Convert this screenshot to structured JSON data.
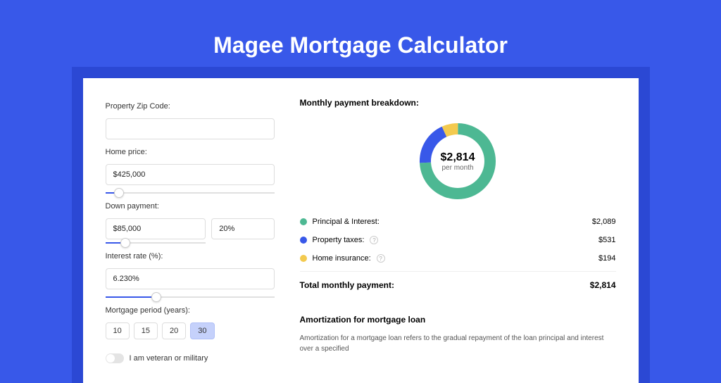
{
  "title": "Magee Mortgage Calculator",
  "form": {
    "zip_label": "Property Zip Code:",
    "zip_value": "",
    "home_price_label": "Home price:",
    "home_price_value": "$425,000",
    "home_price_slider_pos": 8,
    "down_payment_label": "Down payment:",
    "down_payment_value": "$85,000",
    "down_payment_pct_value": "20%",
    "down_payment_slider_pos": 20,
    "rate_label": "Interest rate (%):",
    "rate_value": "6.230%",
    "rate_slider_pos": 30,
    "period_label": "Mortgage period (years):",
    "periods": [
      "10",
      "15",
      "20",
      "30"
    ],
    "selected_period": "30",
    "veteran_label": "I am veteran or military",
    "veteran_on": false
  },
  "breakdown": {
    "heading": "Monthly payment breakdown:",
    "total_value": "$2,814",
    "total_sub": "per month",
    "items": [
      {
        "label": "Principal & Interest:",
        "value": "$2,089",
        "color": "#4db893",
        "has_info": false
      },
      {
        "label": "Property taxes:",
        "value": "$531",
        "color": "#3858e9",
        "has_info": true
      },
      {
        "label": "Home insurance:",
        "value": "$194",
        "color": "#f3ca4f",
        "has_info": true
      }
    ],
    "total_row_label": "Total monthly payment:",
    "total_row_value": "$2,814"
  },
  "amort": {
    "heading": "Amortization for mortgage loan",
    "text": "Amortization for a mortgage loan refers to the gradual repayment of the loan principal and interest over a specified"
  },
  "chart_data": {
    "type": "pie",
    "title": "Monthly payment breakdown",
    "series": [
      {
        "name": "Principal & Interest",
        "value": 2089,
        "color": "#4db893"
      },
      {
        "name": "Property taxes",
        "value": 531,
        "color": "#3858e9"
      },
      {
        "name": "Home insurance",
        "value": 194,
        "color": "#f3ca4f"
      }
    ],
    "total": 2814,
    "unit": "USD/month"
  }
}
